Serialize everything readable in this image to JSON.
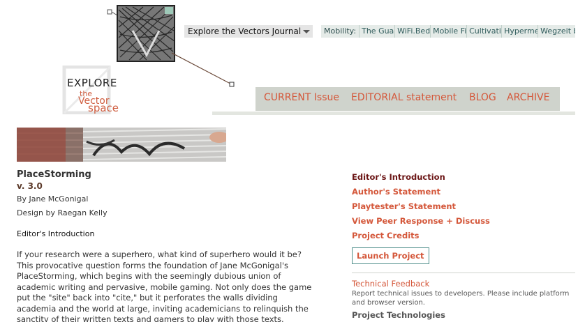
{
  "logo": {
    "line1": "EXPLORE",
    "line2": "the",
    "line3": "Vector",
    "line4": "space"
  },
  "journal_select": {
    "value": "Explore the Vectors Journal"
  },
  "mobility": {
    "label": "Mobility:",
    "items": [
      "The Guan",
      "WiFi.Bedc",
      "Mobile Fig",
      "Cultivatin",
      "Hypermed",
      "Wegzeit b"
    ]
  },
  "nav": {
    "current": "CURRENT Issue",
    "editorial": "EDITORIAL statement",
    "blog": "BLOG",
    "archive": "ARCHIVE"
  },
  "article": {
    "title": "PlaceStorming",
    "version": "v. 3.0",
    "author": "By Jane McGonigal",
    "design": "Design by Raegan Kelly",
    "section": "Editor's Introduction",
    "intro": "If your research were a superhero, what kind of superhero would it be? This provocative question forms the foundation of Jane McGonigal's PlaceStorming, which begins with the seemingly dubious union of academic writing and pervasive, mobile gaming. Not only does the game put the \"site\" back into \"cite,\" but it perforates the walls dividing academia and the world at large, inviting academicians to relinquish the sanctity of their written texts and gamers to play with those texts."
  },
  "sidebar": {
    "links": [
      "Editor's Introduction",
      "Author's Statement",
      "Playtester's Statement",
      "View Peer Response + Discuss",
      "Project Credits"
    ],
    "launch": "Launch Project",
    "tech_feedback_title": "Technical Feedback",
    "tech_feedback_desc": "Report technical issues to developers. Please include platform and browser version.",
    "project_tech": "Project Technologies"
  },
  "colors": {
    "accent": "#d4573a",
    "active_link": "#6b1515",
    "nav_bg": "#cfd3cc",
    "button_border": "#4e8e8a"
  }
}
